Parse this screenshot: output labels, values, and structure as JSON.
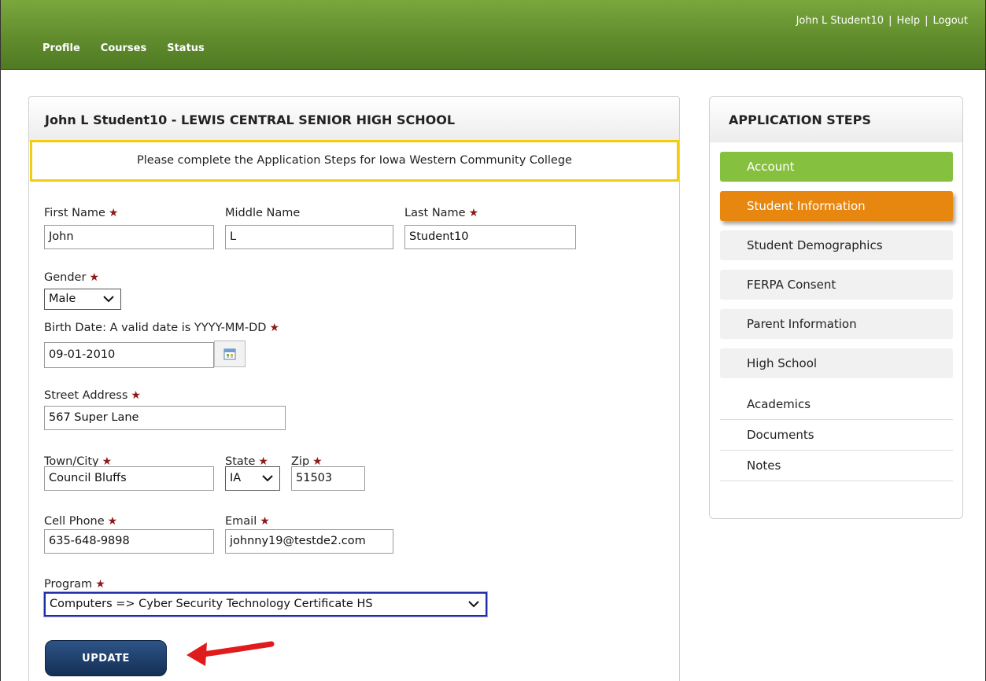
{
  "topnav": {
    "items": [
      "Profile",
      "Courses",
      "Status"
    ],
    "user": "John L Student10",
    "help": "Help",
    "logout": "Logout",
    "sep": "|"
  },
  "panel": {
    "title": "John L Student10 - LEWIS CENTRAL SENIOR HIGH SCHOOL",
    "notice": "Please complete the Application Steps for Iowa Western Community College"
  },
  "form": {
    "first_name": {
      "label": "First Name",
      "value": "John"
    },
    "middle_name": {
      "label": "Middle Name",
      "value": "L"
    },
    "last_name": {
      "label": "Last Name",
      "value": "Student10"
    },
    "gender": {
      "label": "Gender",
      "value": "Male"
    },
    "birth_date": {
      "label": "Birth Date: A valid date is YYYY-MM-DD",
      "value": "09-01-2010"
    },
    "street": {
      "label": "Street Address",
      "value": "567 Super Lane"
    },
    "town": {
      "label": "Town/City",
      "value": "Council Bluffs"
    },
    "state": {
      "label": "State",
      "value": "IA"
    },
    "zip": {
      "label": "Zip",
      "value": "51503"
    },
    "cell": {
      "label": "Cell Phone",
      "value": "635-648-9898"
    },
    "email": {
      "label": "Email",
      "value": "johnny19@testde2.com"
    },
    "program": {
      "label": "Program",
      "value": "Computers => Cyber Security Technology Certificate HS"
    },
    "required_mark": "★",
    "update_label": "UPDATE"
  },
  "steps": {
    "title": "APPLICATION STEPS",
    "items": [
      {
        "label": "Account",
        "state": "done"
      },
      {
        "label": "Student Information",
        "state": "active"
      },
      {
        "label": "Student Demographics",
        "state": "pending"
      },
      {
        "label": "FERPA Consent",
        "state": "pending"
      },
      {
        "label": "Parent Information",
        "state": "pending"
      },
      {
        "label": "High School",
        "state": "pending"
      },
      {
        "label": "Academics",
        "state": "plain"
      },
      {
        "label": "Documents",
        "state": "plain"
      },
      {
        "label": "Notes",
        "state": "plain"
      }
    ]
  },
  "colors": {
    "brand_green": "#5f8a2c",
    "step_done": "#86c03f",
    "step_active": "#e8870f",
    "button_navy": "#142f55",
    "notice_border": "#f2cc0f",
    "annotation_arrow": "#e01b1b"
  }
}
